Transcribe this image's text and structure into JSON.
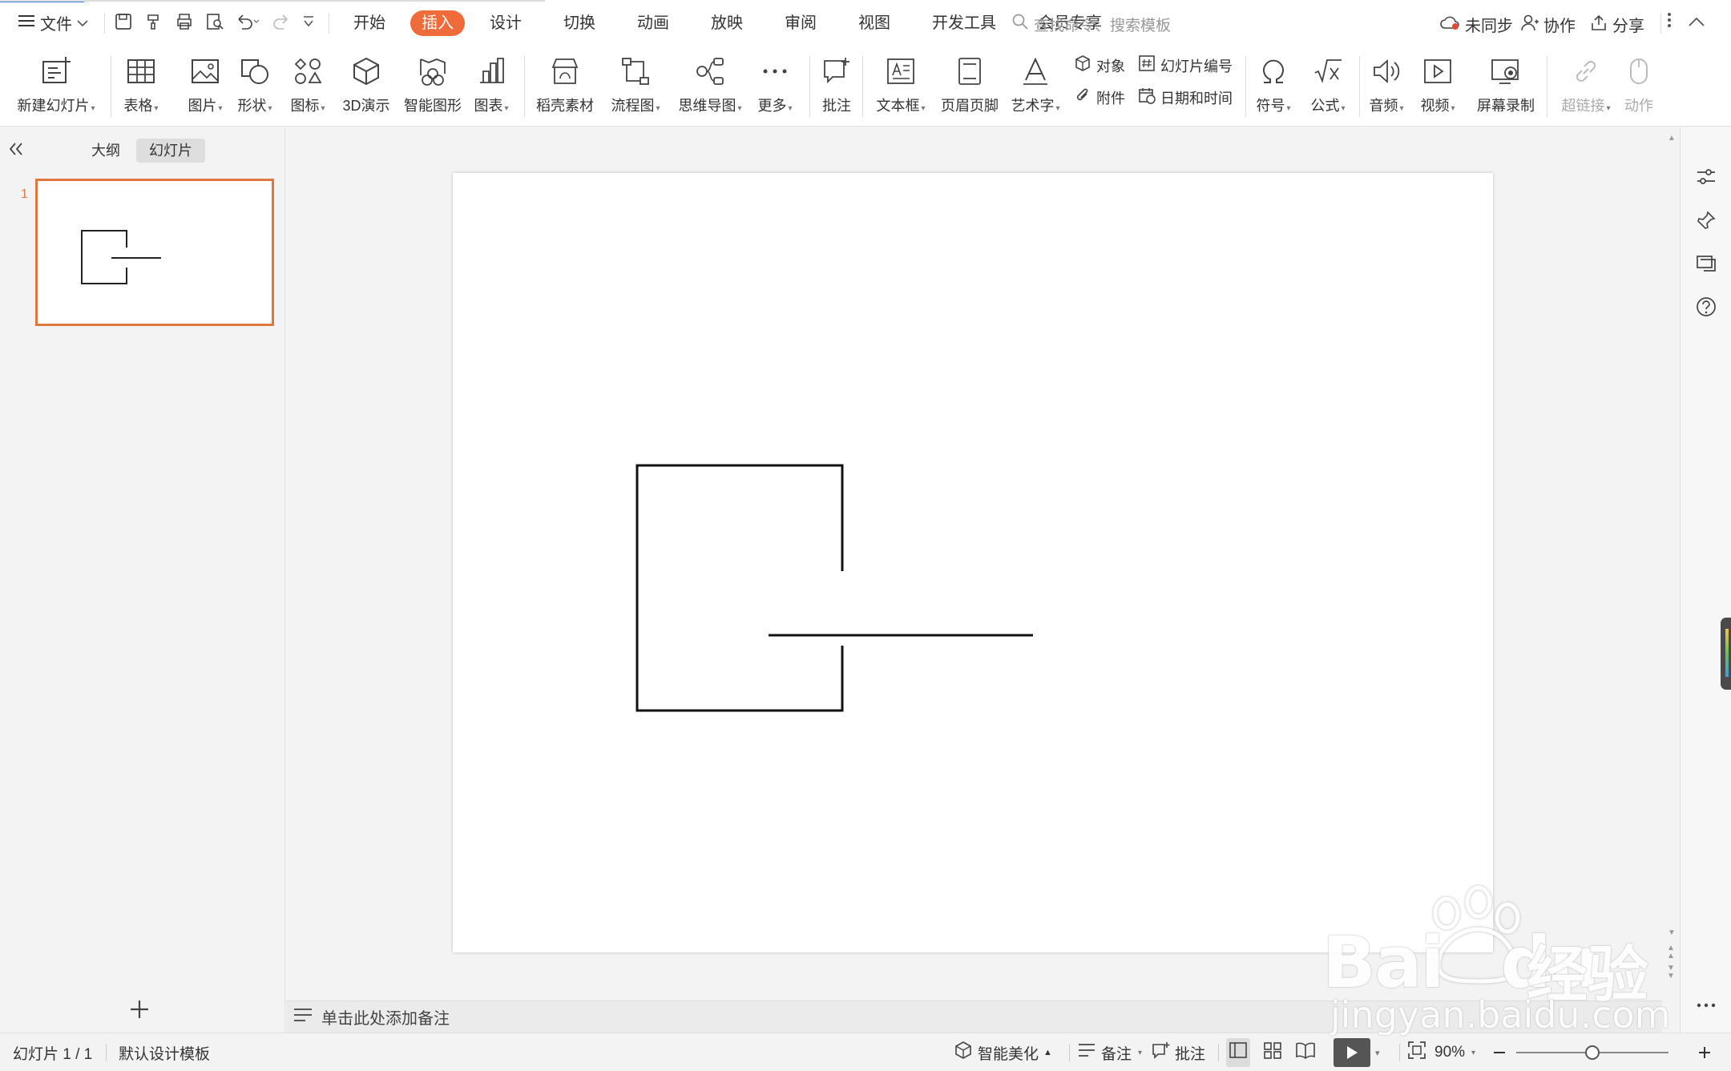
{
  "topbar": {
    "file_label": "文件",
    "tabs": [
      "开始",
      "插入",
      "设计",
      "切换",
      "动画",
      "放映",
      "审阅",
      "视图",
      "开发工具",
      "会员专享"
    ],
    "active_tab": "插入",
    "search_placeholder": "查找命令、搜索模板",
    "sync_label": "未同步",
    "collab_label": "协作",
    "share_label": "分享"
  },
  "ribbon": {
    "new_slide": "新建幻灯片",
    "table": "表格",
    "picture": "图片",
    "shape": "形状",
    "icon": "图标",
    "three_d": "3D演示",
    "smartart": "智能图形",
    "chart": "图表",
    "daoke": "稻壳素材",
    "flowchart": "流程图",
    "mindmap": "思维导图",
    "more": "更多",
    "comment": "批注",
    "textbox": "文本框",
    "header_footer": "页眉页脚",
    "wordart": "艺术字",
    "object": "对象",
    "slide_number": "幻灯片编号",
    "attachment": "附件",
    "datetime": "日期和时间",
    "symbol": "符号",
    "formula": "公式",
    "audio": "音频",
    "video": "视频",
    "screen_record": "屏幕录制",
    "hyperlink": "超链接",
    "action": "动作"
  },
  "panel": {
    "outline_tab": "大纲",
    "slides_tab": "幻灯片",
    "slide_index": "1"
  },
  "notes_placeholder": "单击此处添加备注",
  "status": {
    "slide_count": "幻灯片 1 / 1",
    "template": "默认设计模板",
    "beautify": "智能美化",
    "notes": "备注",
    "comment": "批注",
    "zoom": "90%"
  },
  "watermark": {
    "brand": "Bai",
    "brand2": "du",
    "cn": "经验",
    "url": "jingyan.baidu.com"
  },
  "colors": {
    "accent": "#ef6b3a",
    "thumb_border": "#e0783e"
  }
}
